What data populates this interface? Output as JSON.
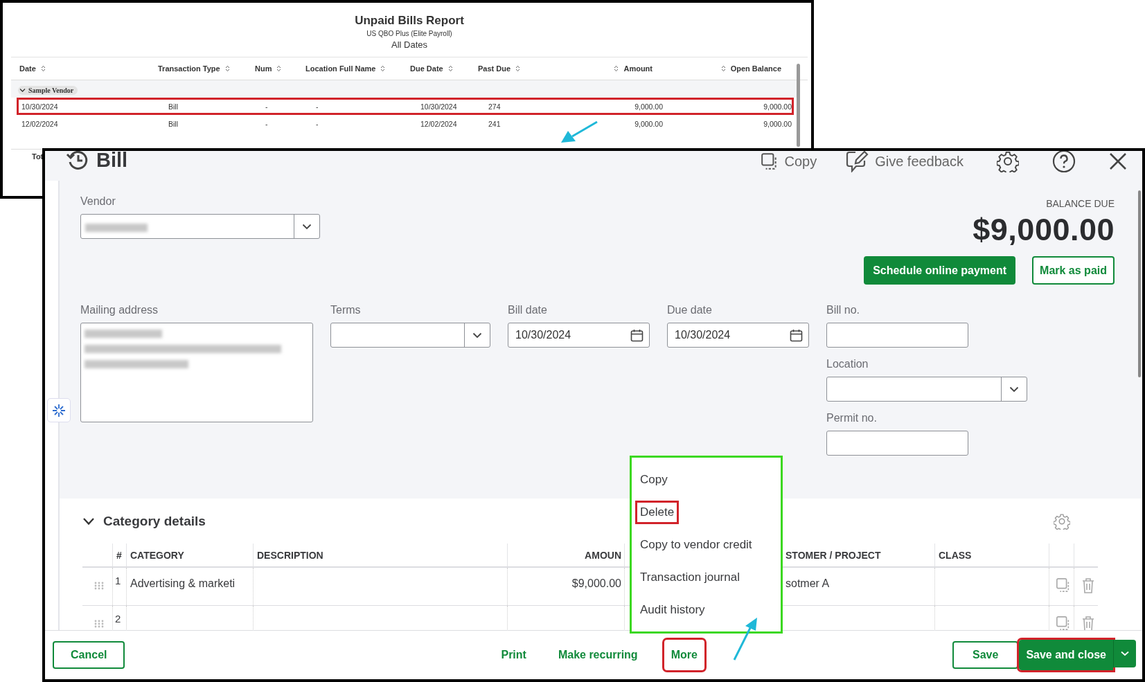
{
  "report": {
    "title": "Unpaid Bills Report",
    "subtitle": "US QBO Plus (Elite Payroll)",
    "period": "All Dates",
    "columns": [
      "Date",
      "Transaction Type",
      "Num",
      "Location Full Name",
      "Due Date",
      "Past Due",
      "Amount",
      "Open Balance"
    ],
    "groups": [
      {
        "name": "Sample Vendor",
        "expanded": true,
        "rows": [
          {
            "annotated": true,
            "cells": [
              "10/30/2024",
              "Bill",
              "-",
              "-",
              "10/30/2024",
              "274",
              "9,000.00",
              "9,000.00"
            ]
          },
          {
            "annotated": false,
            "cells": [
              "12/02/2024",
              "Bill",
              "-",
              "-",
              "12/02/2024",
              "241",
              "9,000.00",
              "9,000.00"
            ]
          }
        ]
      }
    ],
    "total_label": "Tot"
  },
  "bill": {
    "title": "Bill",
    "toolbar": [
      {
        "label": "Copy",
        "kind": "copy"
      },
      {
        "label": "Give feedback",
        "kind": "feedback"
      }
    ],
    "vendor": {
      "label": "Vendor"
    },
    "balance": {
      "label": "BALANCE DUE",
      "amount": "$9,000.00"
    },
    "actions": [
      {
        "label": "Schedule online payment",
        "kind": "primary"
      },
      {
        "label": "Mark as paid",
        "kind": "outline"
      }
    ],
    "mailing_address": {
      "label": "Mailing address"
    },
    "terms": {
      "label": "Terms"
    },
    "bill_date": {
      "label": "Bill date",
      "value": "10/30/2024"
    },
    "due_date": {
      "label": "Due date",
      "value": "10/30/2024"
    },
    "bill_no": {
      "label": "Bill no."
    },
    "location": {
      "label": "Location"
    },
    "permit_no": {
      "label": "Permit no."
    },
    "category": {
      "title": "Category details",
      "expanded": true,
      "columns": [
        "#",
        "CATEGORY",
        "DESCRIPTION",
        "AMOUN",
        "STOMER / PROJECT",
        "CLASS"
      ],
      "rows": [
        {
          "number": "1",
          "category": "Advertising & marketi",
          "amount": "$9,000.00",
          "customer": "sotmer A"
        },
        {
          "number": "2"
        }
      ]
    },
    "menu": [
      {
        "label": "Copy",
        "annotated": false
      },
      {
        "label": "Delete",
        "annotated": true
      },
      {
        "label": "Copy to vendor credit",
        "annotated": false
      },
      {
        "label": "Transaction journal",
        "annotated": false
      },
      {
        "label": "Audit history",
        "annotated": false
      }
    ],
    "footer": {
      "left": [
        {
          "label": "Cancel",
          "kind": "outline",
          "annotated": false
        }
      ],
      "center": [
        {
          "label": "Print",
          "kind": "link",
          "annotated": false
        },
        {
          "label": "Make recurring",
          "kind": "link",
          "annotated": false
        },
        {
          "label": "More",
          "kind": "link",
          "annotated": true
        }
      ],
      "right": [
        {
          "label": "Save",
          "kind": "outline",
          "annotated": false
        },
        {
          "label": "Save and close",
          "kind": "split",
          "annotated": true
        }
      ]
    }
  }
}
